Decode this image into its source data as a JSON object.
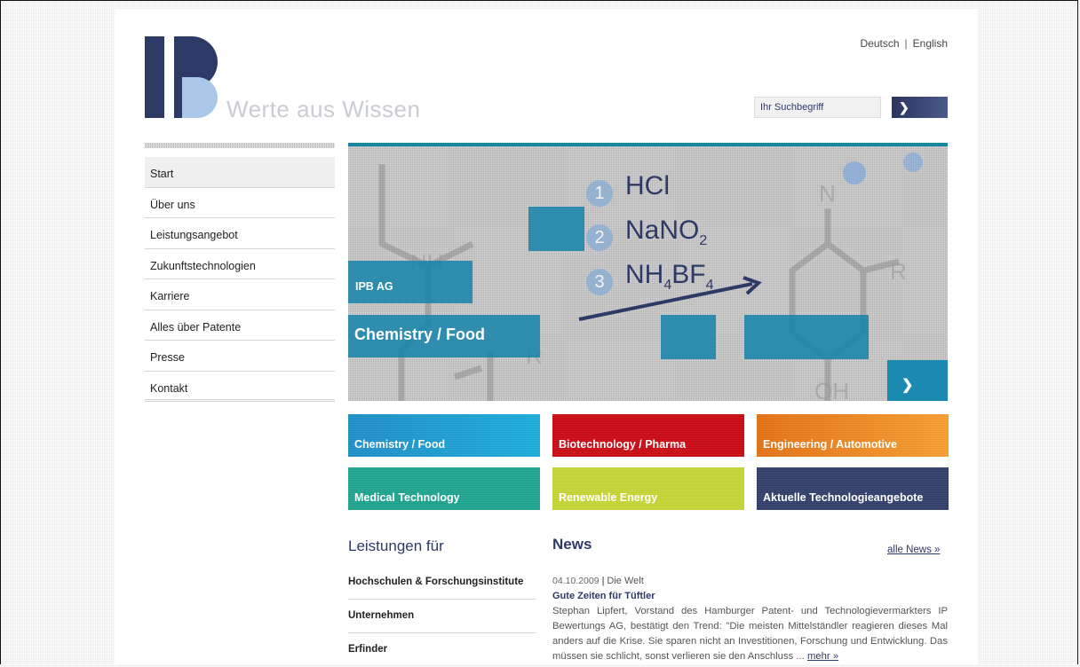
{
  "header": {
    "logo_text": "IPB",
    "slogan": "Werte aus Wissen",
    "lang": [
      "Deutsch",
      "English"
    ],
    "search_placeholder": "Ihr Suchbegriff"
  },
  "nav": {
    "items": [
      {
        "label": "Start"
      },
      {
        "label": "Über uns"
      },
      {
        "label": "Leistungsangebot"
      },
      {
        "label": "Zukunftstechnologien"
      },
      {
        "label": "Karriere"
      },
      {
        "label": "Alles über Patente"
      },
      {
        "label": "Presse"
      },
      {
        "label": "Kontakt"
      }
    ]
  },
  "hero": {
    "label_small": "IPB AG",
    "label_large": "Chemistry / Food",
    "formulas": [
      "HCl",
      "NaNO",
      "NH",
      "BF"
    ],
    "formula_subs": [
      "2",
      "4",
      "4"
    ],
    "numbers": [
      "1",
      "2",
      "3"
    ]
  },
  "tiles": [
    {
      "label": "Chemistry / Food",
      "color": "#1a8ac4"
    },
    {
      "label": "Biotechnology / Pharma",
      "color": "#c6050f"
    },
    {
      "label": "Engineering / Automotive",
      "color": "#e06d10"
    },
    {
      "label": "Medical Technology",
      "color": "#18a08a"
    },
    {
      "label": "Renewable Energy",
      "color": "#c0d230"
    },
    {
      "label": "Aktuelle Technologieangebote",
      "color": "#2e3a66"
    }
  ],
  "leistungen": {
    "title": "Leistungen für",
    "items": [
      "Hochschulen & Forschungsinstitute",
      "Unternehmen",
      "Erfinder"
    ]
  },
  "news": {
    "title": "News",
    "all_link": "alle News »",
    "date": "04.10.2009",
    "source": "Die Welt",
    "headline": "Gute Zeiten für Tüftler",
    "body": "Stephan Lipfert, Vorstand des Hamburger Patent- und Technologievermarkters IP Bewertungs AG, bestätigt den Trend: \"Die meisten Mittelständler reagieren dieses Mal anders auf die Krise. Sie sparen nicht an Investitionen, Forschung und Entwicklung. Das müssen sie schlicht, sonst verlieren sie den Anschluss ...",
    "more": "mehr »"
  }
}
